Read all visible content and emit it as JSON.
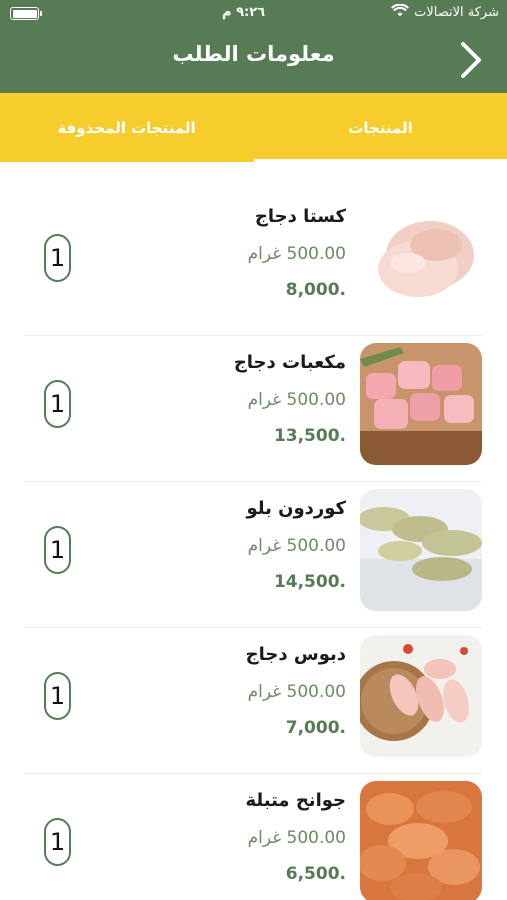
{
  "status_bar": {
    "carrier": "شركة الاتصالات",
    "time": "٩:٢٦ م",
    "wifi_icon": "wifi-icon",
    "battery_icon": "battery-icon"
  },
  "header": {
    "title": "معلومات الطلب",
    "back_icon": "chevron-right-icon"
  },
  "tabs": [
    {
      "label": "المنتجات",
      "active": true
    },
    {
      "label": "المنتجات المحذوفة",
      "active": false
    }
  ],
  "colors": {
    "primary_green": "#567b55",
    "accent_yellow": "#f6cd2c",
    "weight_green": "#6c8c62"
  },
  "products": [
    {
      "name": "كستا دجاج",
      "weight": "500.00 غرام",
      "price": "8,000.",
      "quantity": "1",
      "image": "chicken-leg-quarters-image"
    },
    {
      "name": "مكعبات دجاج",
      "weight": "500.00 غرام",
      "price": "13,500.",
      "quantity": "1",
      "image": "chicken-cubes-image"
    },
    {
      "name": "كوردون بلو",
      "weight": "500.00 غرام",
      "price": "14,500.",
      "quantity": "1",
      "image": "cordon-bleu-image"
    },
    {
      "name": "دبوس دجاج",
      "weight": "500.00 غرام",
      "price": "7,000.",
      "quantity": "1",
      "image": "chicken-drumsticks-image"
    },
    {
      "name": "جوانح متبلة",
      "weight": "500.00 غرام",
      "price": "6,500.",
      "quantity": "1",
      "image": "marinated-wings-image"
    }
  ]
}
